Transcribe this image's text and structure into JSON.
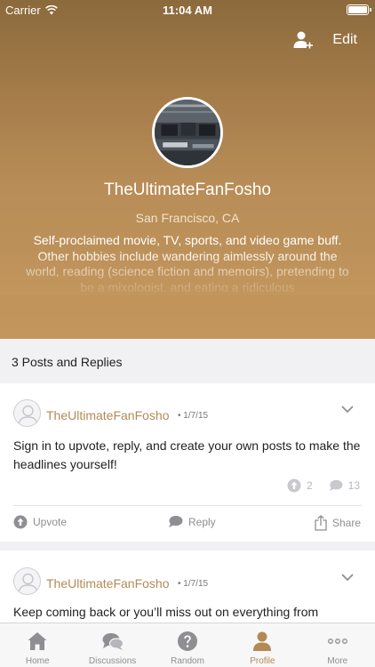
{
  "status": {
    "carrier": "Carrier",
    "time": "11:04 AM"
  },
  "header": {
    "edit_label": "Edit",
    "add_user_icon": "add-user-icon"
  },
  "profile": {
    "username": "TheUltimateFanFosho",
    "location": "San Francisco, CA",
    "bio": "Self-proclaimed movie, TV, sports, and video game buff. Other hobbies include wandering aimlessly around the world, reading (science fiction and memoirs), pretending to be a mixologist, and eating a ridiculous"
  },
  "section": {
    "title": "3 Posts and Replies"
  },
  "posts": [
    {
      "author": "TheUltimateFanFosho",
      "date": "• 1/7/15",
      "body": "Sign in to upvote, reply, and create your own posts to make the headlines yourself!",
      "upvotes": "2",
      "comments": "13",
      "actions": {
        "upvote": "Upvote",
        "reply": "Reply",
        "share": "Share"
      }
    },
    {
      "author": "TheUltimateFanFosho",
      "date": "• 1/7/15",
      "body": "Keep coming back or you’ll miss out on everything from"
    }
  ],
  "tabs": [
    {
      "label": "Home",
      "icon": "home-icon"
    },
    {
      "label": "Discussions",
      "icon": "discussions-icon"
    },
    {
      "label": "Random",
      "icon": "random-icon"
    },
    {
      "label": "Profile",
      "icon": "profile-icon",
      "active": true
    },
    {
      "label": "More",
      "icon": "more-icon"
    }
  ],
  "colors": {
    "accent": "#b38a55",
    "tab_inactive": "#8e8e93",
    "hero_top": "#8b6a3c",
    "hero_bottom": "#c3965c"
  }
}
